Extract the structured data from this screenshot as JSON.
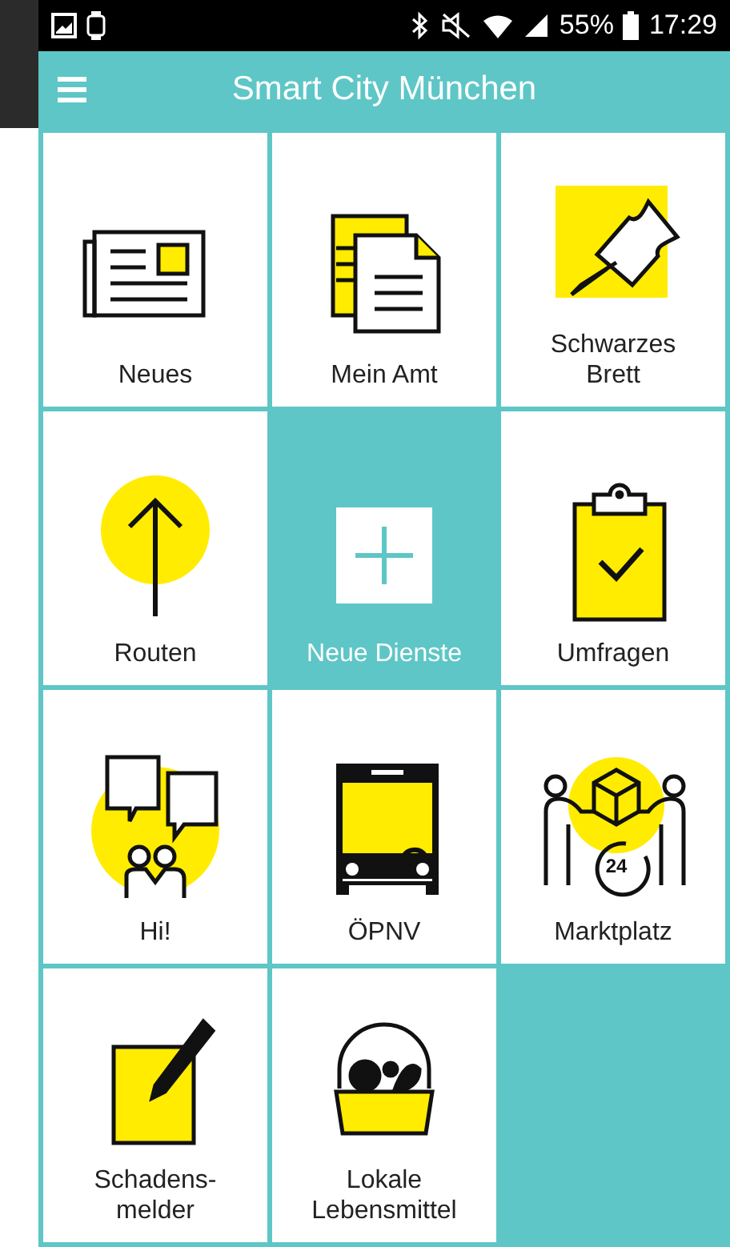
{
  "status_bar": {
    "battery": "55%",
    "time": "17:29"
  },
  "app_bar": {
    "title": "Smart City München"
  },
  "tiles": [
    {
      "label": "Neues",
      "kind": "newspaper"
    },
    {
      "label": "Mein Amt",
      "kind": "documents"
    },
    {
      "label": "Schwarzes\nBrett",
      "kind": "pin"
    },
    {
      "label": "Routen",
      "kind": "arrow"
    },
    {
      "label": "Neue Dienste",
      "kind": "add"
    },
    {
      "label": "Umfragen",
      "kind": "clipboard"
    },
    {
      "label": "Hi!",
      "kind": "chat"
    },
    {
      "label": "ÖPNV",
      "kind": "bus"
    },
    {
      "label": "Marktplatz",
      "kind": "market",
      "icon_text": "24"
    },
    {
      "label": "Schadens-\nmelder",
      "kind": "pencil"
    },
    {
      "label": "Lokale\nLebensmittel",
      "kind": "basket"
    }
  ]
}
